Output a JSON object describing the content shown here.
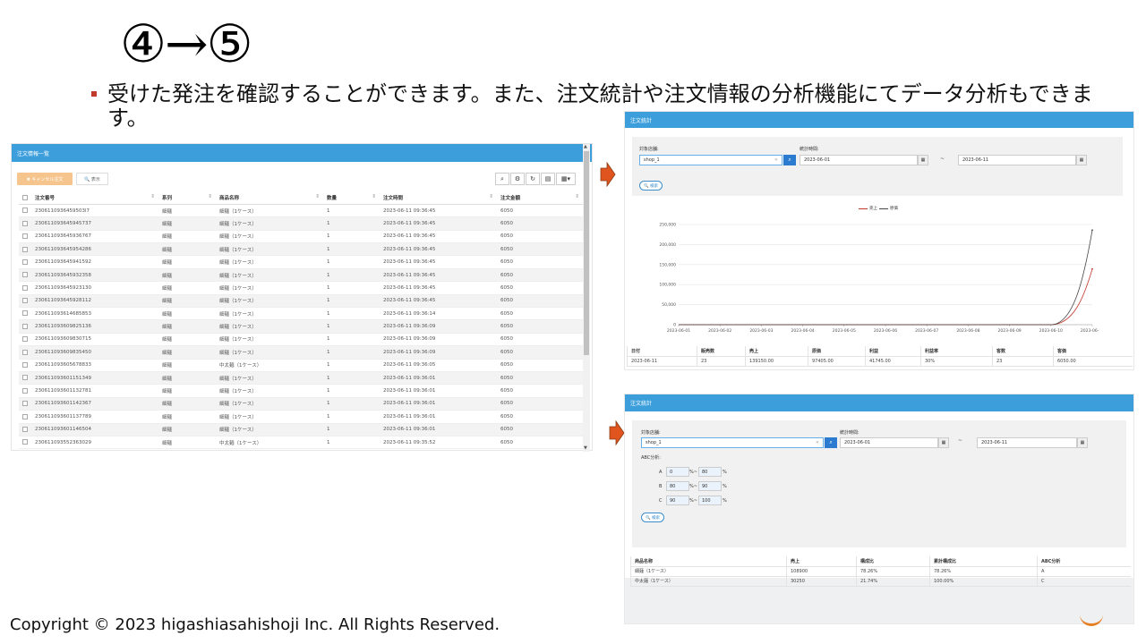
{
  "slide": {
    "heading": "④→⑤",
    "bullet": "受けた発注を確認することができます。また、注文統計や注文情報の分析機能にてデータ分析もできます。",
    "copyright": "Copyright © 2023 higashiasahishoji Inc. All Rights Reserved."
  },
  "colors": {
    "panel_header": "#3c9fdc",
    "accent_orange": "#e0551f",
    "series_sales": "#c0392b",
    "series_cost": "#444444"
  },
  "order_list": {
    "title": "注文情報一覧",
    "cancel_button": "✖ キャンセル注文",
    "show_button": "🔍 表示",
    "toolbar_icons": [
      "search-icon",
      "settings-icon",
      "refresh-icon",
      "columns-icon",
      "grid-menu-icon"
    ],
    "columns": [
      "注文番号",
      "系列",
      "商品名称",
      "数量",
      "注文時間",
      "注文金額"
    ],
    "rows": [
      [
        "2306110936459503l7",
        "細麺",
        "細麺（1ケース）",
        "1",
        "2023-06-11 09:36:45",
        "6050"
      ],
      [
        "230611093645945737",
        "細麺",
        "細麺（1ケース）",
        "1",
        "2023-06-11 09:36:45",
        "6050"
      ],
      [
        "230611093645936767",
        "細麺",
        "細麺（1ケース）",
        "1",
        "2023-06-11 09:36:45",
        "6050"
      ],
      [
        "230611093645954286",
        "細麺",
        "細麺（1ケース）",
        "1",
        "2023-06-11 09:36:45",
        "6050"
      ],
      [
        "230611093645941592",
        "細麺",
        "細麺（1ケース）",
        "1",
        "2023-06-11 09:36:45",
        "6050"
      ],
      [
        "230611093645932358",
        "細麺",
        "細麺（1ケース）",
        "1",
        "2023-06-11 09:36:45",
        "6050"
      ],
      [
        "230611093645923130",
        "細麺",
        "細麺（1ケース）",
        "1",
        "2023-06-11 09:36:45",
        "6050"
      ],
      [
        "230611093645928112",
        "細麺",
        "細麺（1ケース）",
        "1",
        "2023-06-11 09:36:45",
        "6050"
      ],
      [
        "230611093614685853",
        "細麺",
        "細麺（1ケース）",
        "1",
        "2023-06-11 09:36:14",
        "6050"
      ],
      [
        "230611093609825136",
        "細麺",
        "細麺（1ケース）",
        "1",
        "2023-06-11 09:36:09",
        "6050"
      ],
      [
        "230611093609830715",
        "細麺",
        "細麺（1ケース）",
        "1",
        "2023-06-11 09:36:09",
        "6050"
      ],
      [
        "230611093609835450",
        "細麺",
        "細麺（1ケース）",
        "1",
        "2023-06-11 09:36:09",
        "6050"
      ],
      [
        "230611093605678833",
        "細麺",
        "中太麺（1ケース）",
        "1",
        "2023-06-11 09:36:05",
        "6050"
      ],
      [
        "230611093601151349",
        "細麺",
        "細麺（1ケース）",
        "1",
        "2023-06-11 09:36:01",
        "6050"
      ],
      [
        "230611093601132781",
        "細麺",
        "細麺（1ケース）",
        "1",
        "2023-06-11 09:36:01",
        "6050"
      ],
      [
        "230611093601142367",
        "細麺",
        "細麺（1ケース）",
        "1",
        "2023-06-11 09:36:01",
        "6050"
      ],
      [
        "230611093601137789",
        "細麺",
        "細麺（1ケース）",
        "1",
        "2023-06-11 09:36:01",
        "6050"
      ],
      [
        "230611093601146504",
        "細麺",
        "細麺（1ケース）",
        "1",
        "2023-06-11 09:36:01",
        "6050"
      ],
      [
        "230611093552363029",
        "細麺",
        "中太麺（1ケース）",
        "1",
        "2023-06-11 09:35:52",
        "6050"
      ]
    ]
  },
  "stats": {
    "title": "注文統計",
    "shop_label": "対象店舗:",
    "period_label": "統計時間:",
    "shop_value": "shop_1",
    "date_from": "2023-06-01",
    "tilde": "~",
    "date_to": "2023-06-11",
    "search_button": "🔍 検索",
    "summary_columns": [
      "日付",
      "販売数",
      "売上",
      "原価",
      "利益",
      "利益率",
      "客数",
      "客価"
    ],
    "summary_row": [
      "2023-06-11",
      "23",
      "139150.00",
      "97405.00",
      "41745.00",
      "30%",
      "23",
      "6050.00"
    ]
  },
  "chart_data": {
    "type": "line",
    "x": [
      "2023-06-01",
      "2023-06-02",
      "2023-06-03",
      "2023-06-04",
      "2023-06-05",
      "2023-06-06",
      "2023-06-07",
      "2023-06-08",
      "2023-06-09",
      "2023-06-10",
      "2023-06-11"
    ],
    "series": [
      {
        "name": "売上",
        "color": "#c0392b",
        "values": [
          0,
          0,
          0,
          0,
          0,
          0,
          0,
          0,
          0,
          0,
          139150
        ]
      },
      {
        "name": "原価",
        "color": "#444444",
        "values": [
          0,
          0,
          0,
          0,
          0,
          0,
          0,
          0,
          0,
          0,
          236000
        ]
      }
    ],
    "yticks": [
      "0",
      "50,000",
      "100,000",
      "150,000",
      "200,000",
      "250,000"
    ],
    "ylim": [
      0,
      250000
    ],
    "grid": true,
    "legend_position": "top-center"
  },
  "abc": {
    "title": "注文統計",
    "shop_label": "対象店舗:",
    "period_label": "統計時間:",
    "shop_value": "shop_1",
    "date_from": "2023-06-01",
    "tilde": "~",
    "date_to": "2023-06-11",
    "analysis_label": "ABC分析:",
    "pct": "%",
    "dash": "%~",
    "ranks": [
      {
        "label": "A",
        "from": "0",
        "to": "80"
      },
      {
        "label": "B",
        "from": "80",
        "to": "90"
      },
      {
        "label": "C",
        "from": "90",
        "to": "100"
      }
    ],
    "search_button": "🔍 検索",
    "columns": [
      "商品名称",
      "売上",
      "構成比",
      "累計構成比",
      "ABC分析"
    ],
    "rows": [
      [
        "細麺（1ケース）",
        "108900",
        "78.26%",
        "78.26%",
        "A"
      ],
      [
        "中太麺（1ケース）",
        "30250",
        "21.74%",
        "100.00%",
        "C"
      ]
    ]
  }
}
